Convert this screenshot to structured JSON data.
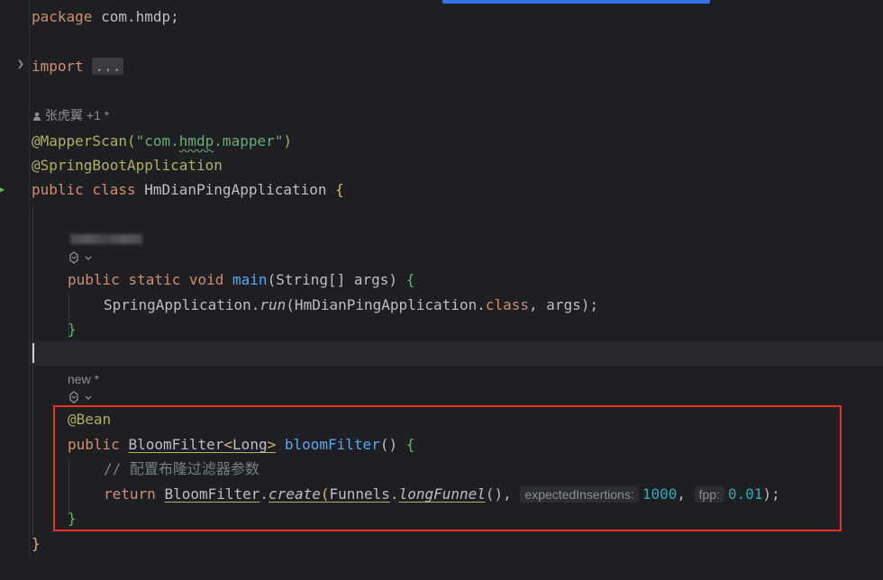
{
  "editor": {
    "lines": {
      "package": {
        "kw": "package",
        "rest": " com.hmdp;"
      },
      "import": {
        "kw": "import",
        "fold": "..."
      },
      "mapperscan": {
        "ann": "@MapperScan(",
        "str_a": "\"com.",
        "str_b": "hmdp",
        "str_c": ".mapper\"",
        "close": ")"
      },
      "springboot": {
        "ann": "@SpringBootApplication"
      },
      "class_decl": {
        "kw": "public class ",
        "name": "HmDianPingApplication ",
        "brace": "{"
      },
      "main_decl": {
        "kw1": "public static void ",
        "fn": "main",
        "params": "(String[] args) ",
        "brace": "{"
      },
      "run_call": {
        "cls": "SpringApplication.",
        "fn": "run",
        "args_a": "(HmDianPingApplication.",
        "kw": "class",
        "args_b": ", args);"
      },
      "main_close": {
        "brace": "}"
      },
      "bean_ann": {
        "ann": "@Bean"
      },
      "bloom_decl": {
        "kw": "public ",
        "type": "BloomFilter",
        "generic_open": "<",
        "generic_type": "Long",
        "generic_close": ">",
        "space": " ",
        "fn": "bloomFilter",
        "params": "() ",
        "brace": "{"
      },
      "comment": {
        "text": "// 配置布隆过滤器参数"
      },
      "return_stmt": {
        "kw": "return ",
        "cls": "BloomFilter",
        "dot1": ".",
        "fn": "create",
        "paren": "(",
        "funnels": "Funnels",
        "dot2": ".",
        "long_funnel": "longFunnel",
        "call": "(), ",
        "hint1": "expectedInsertions:",
        "num1": "1000",
        "comma": ", ",
        "hint2": "fpp:",
        "num2": "0.01",
        "end": ");"
      },
      "bloom_close": {
        "brace": "}"
      },
      "class_close": {
        "brace": "}"
      }
    },
    "author_hint": "张虎翼 +1 *",
    "new_hint": "new *"
  },
  "colors": {
    "background": "#1e1f22",
    "keyword": "#cf8e6d",
    "annotation": "#b3ae60",
    "string": "#6aab73",
    "function": "#56a8f5",
    "number": "#2aacb8",
    "highlight_border": "#e2341d"
  },
  "icons": [
    "fold-chevron-icon",
    "run-gutter-icon",
    "user-icon",
    "ai-assistant-icon",
    "chevron-down-icon"
  ]
}
